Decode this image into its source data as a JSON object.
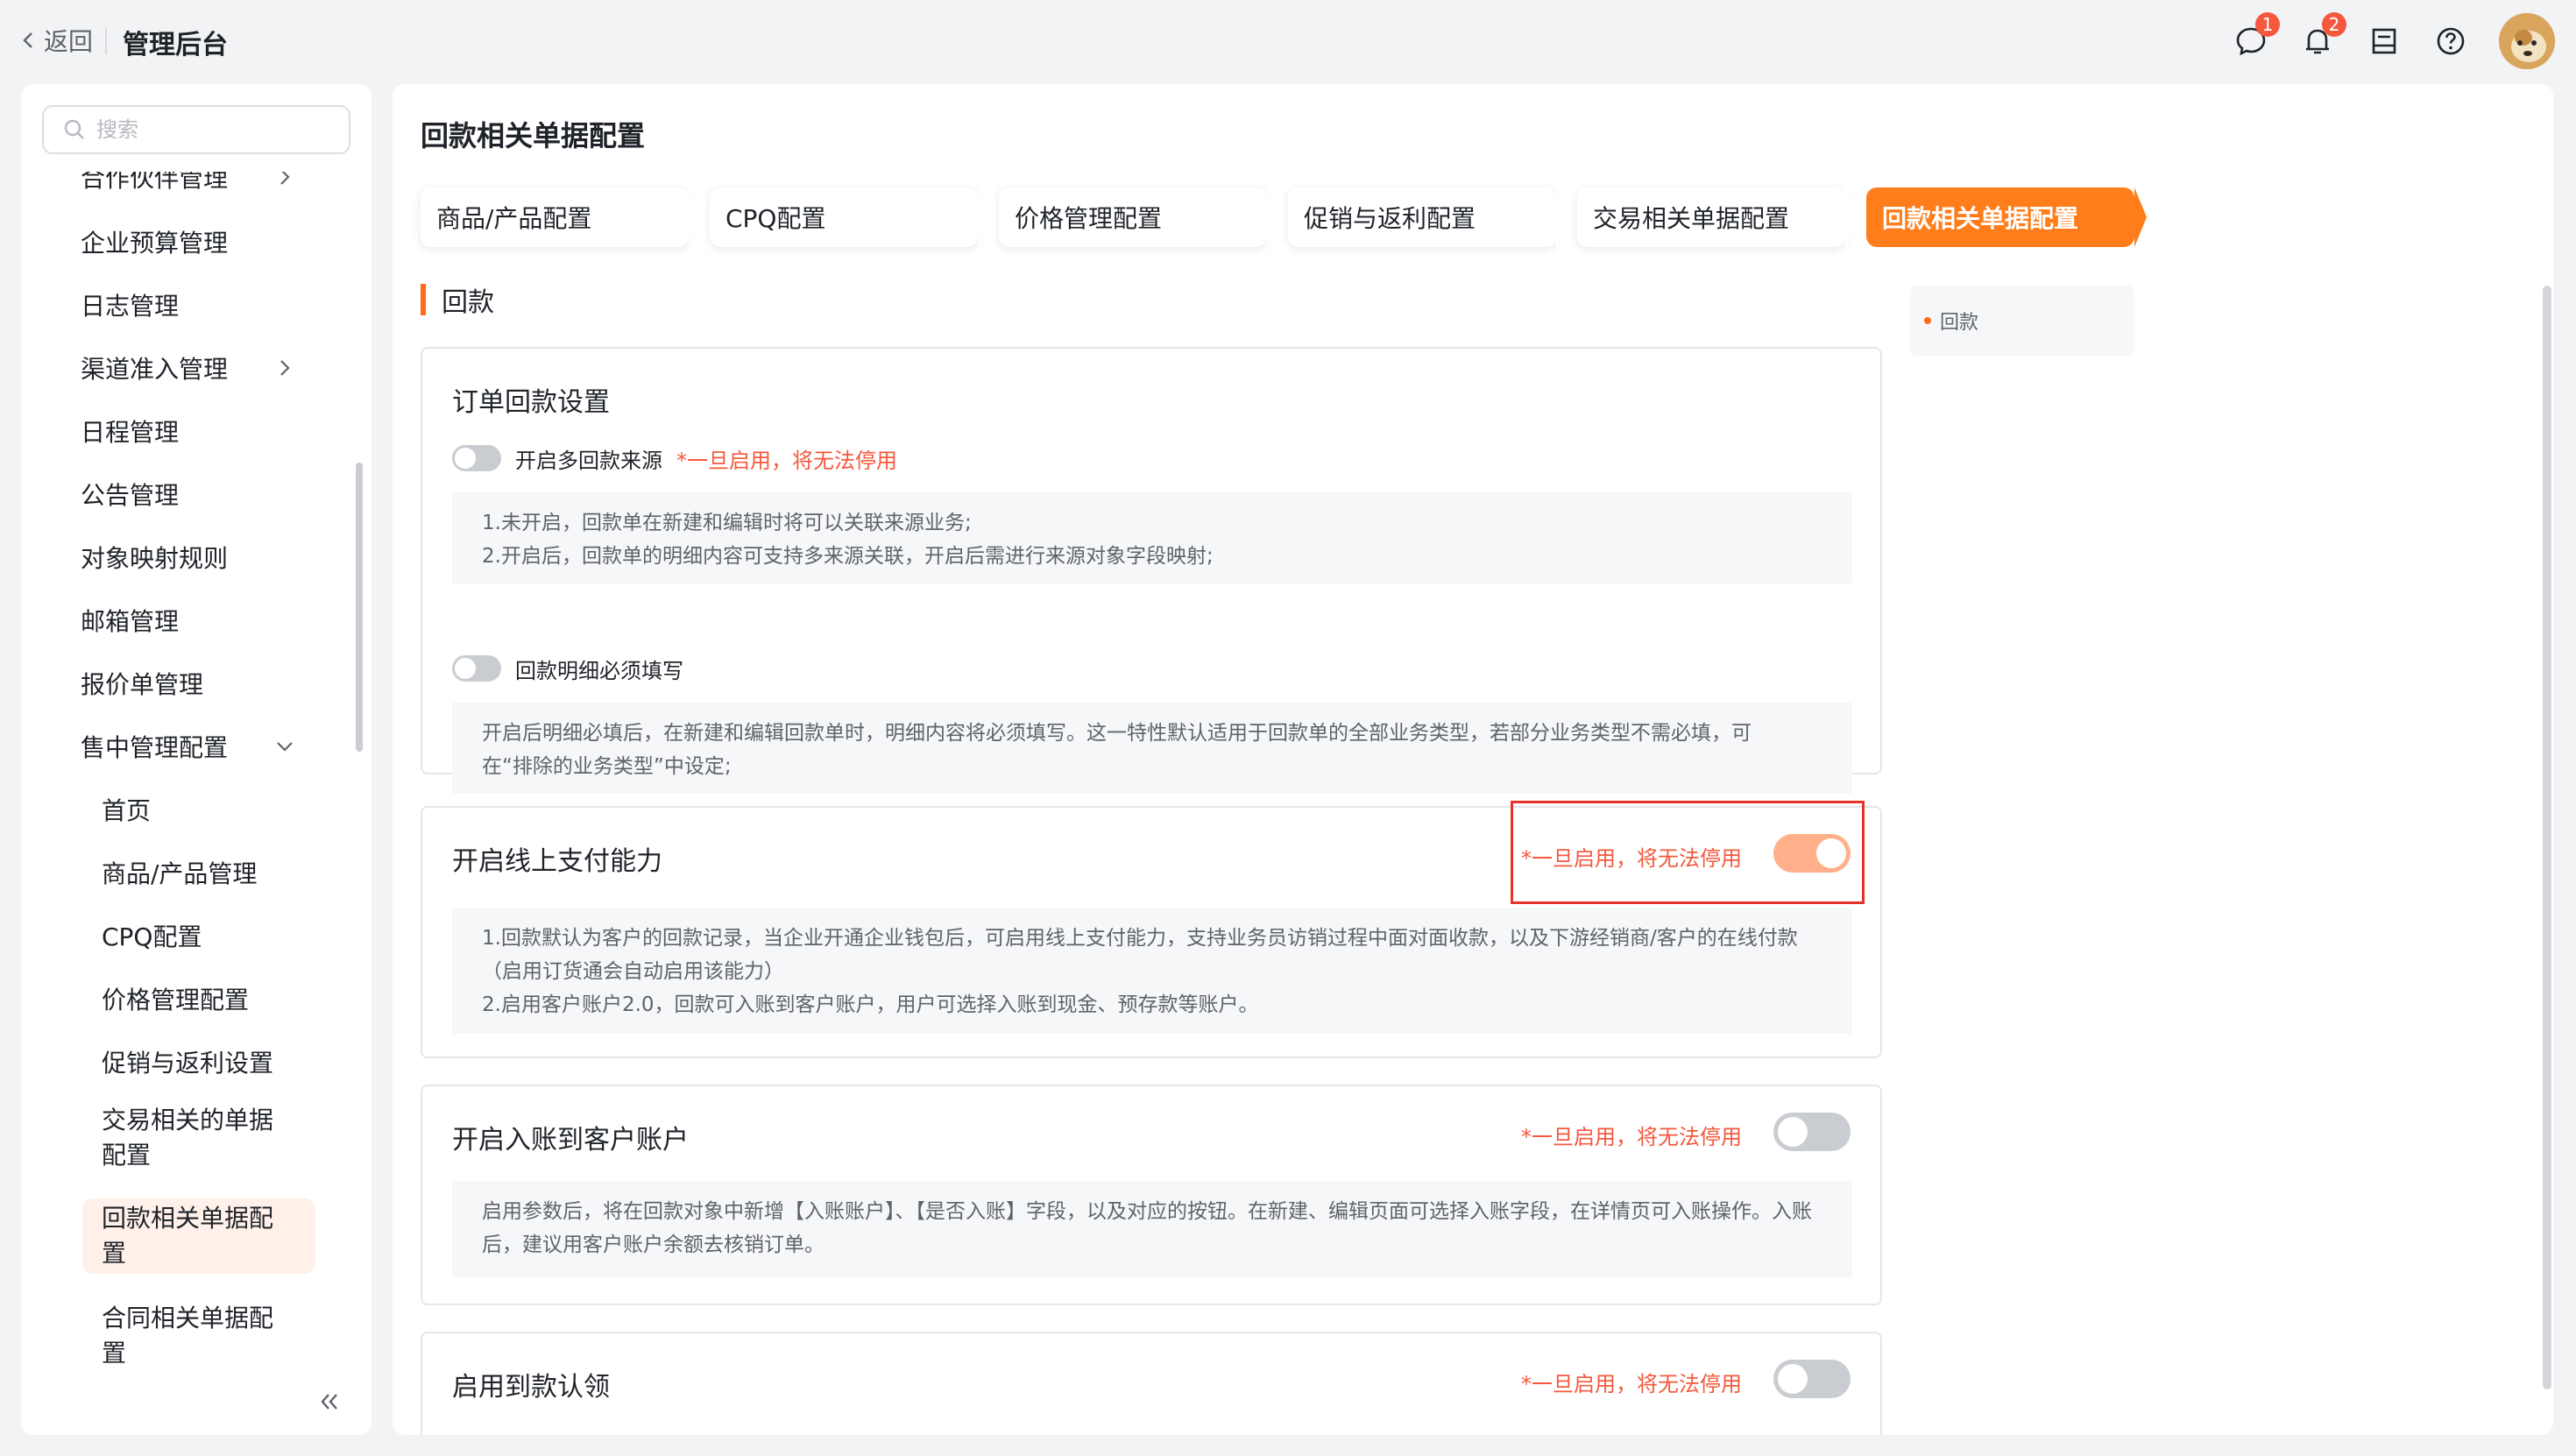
{
  "header": {
    "back_label": "返回",
    "title": "管理后台",
    "icons": [
      {
        "name": "chat-icon",
        "badge": "1"
      },
      {
        "name": "bell-icon",
        "badge": "2"
      },
      {
        "name": "inbox-icon",
        "badge": ""
      },
      {
        "name": "help-icon",
        "badge": ""
      }
    ]
  },
  "sidebar": {
    "search_placeholder": "搜索",
    "items": [
      {
        "label": "合作伙伴管理",
        "arrow": "right"
      },
      {
        "label": "企业预算管理"
      },
      {
        "label": "日志管理"
      },
      {
        "label": "渠道准入管理",
        "arrow": "right"
      },
      {
        "label": "日程管理"
      },
      {
        "label": "公告管理"
      },
      {
        "label": "对象映射规则"
      },
      {
        "label": "邮箱管理"
      },
      {
        "label": "报价单管理"
      },
      {
        "label": "售中管理配置",
        "arrow": "down"
      },
      {
        "label": "首页"
      },
      {
        "label": "商品/产品管理"
      },
      {
        "label": "CPQ配置"
      },
      {
        "label": "价格管理配置"
      },
      {
        "label": "促销与返利设置"
      },
      {
        "label": "交易相关的单据配置"
      },
      {
        "label": "回款相关单据配置"
      },
      {
        "label": "合同相关单据配置"
      }
    ]
  },
  "main": {
    "title": "回款相关单据配置",
    "tabs": [
      "商品/产品配置",
      "CPQ配置",
      "价格管理配置",
      "促销与返利配置",
      "交易相关单据配置",
      "回款相关单据配置"
    ],
    "active_tab": 5,
    "section": "回款",
    "anchor": "回款",
    "cards": {
      "order": {
        "title": "订单回款设置",
        "opt1_label": "开启多回款来源",
        "opt1_warn": "*一旦启用，将无法停用",
        "opt1_desc": "1.未开启，回款单在新建和编辑时将可以关联来源业务;\n2.开启后，回款单的明细内容可支持多来源关联，开启后需进行来源对象字段映射;",
        "opt2_label": "回款明细必须填写",
        "opt2_desc": "开启后明细必填后，在新建和编辑回款单时，明细内容将必须填写。这一特性默认适用于回款单的全部业务类型，若部分业务类型不需必填，可在“排除的业务类型”中设定;"
      },
      "online_pay": {
        "title": "开启线上支付能力",
        "warn": "*一旦启用，将无法停用",
        "enabled": true,
        "desc": "1.回款默认为客户的回款记录，当企业开通企业钱包后，可启用线上支付能力，支持业务员访销过程中面对面收款，以及下游经销商/客户的在线付款（启用订货通会自动启用该能力）\n2.启用客户账户2.0，回款可入账到客户账户，用户可选择入账到现金、预存款等账户。"
      },
      "account": {
        "title": "开启入账到客户账户",
        "warn": "*一旦启用，将无法停用",
        "enabled": false,
        "desc": "启用参数后，将在回款对象中新增【入账账户】、【是否入账】字段，以及对应的按钮。在新建、编辑页面可选择入账字段，在详情页可入账操作。入账后，建议用客户账户余额去核销订单。"
      },
      "claim": {
        "title": "启用到款认领",
        "warn": "*一旦启用，将无法停用",
        "enabled": false
      }
    }
  },
  "colors": {
    "accent": "#ff7d1a",
    "warning": "#f5583d",
    "toggle_on": "#ffb08a",
    "highlight_box": "#e6332a"
  }
}
